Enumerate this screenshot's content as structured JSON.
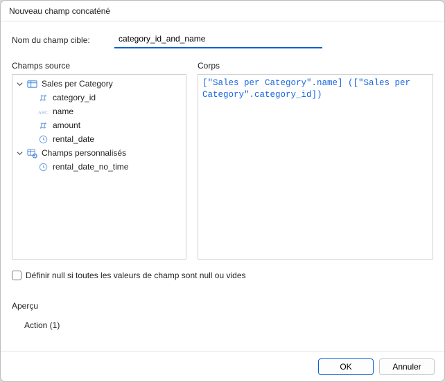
{
  "title": "Nouveau champ concaténé",
  "target": {
    "label": "Nom du champ cible:",
    "value": "category_id_and_name"
  },
  "source": {
    "label": "Champs source",
    "nodes": [
      {
        "type": "group",
        "icon": "table-icon",
        "label": "Sales per Category"
      },
      {
        "type": "field",
        "icon": "hash-icon",
        "label": "category_id"
      },
      {
        "type": "field",
        "icon": "abc-icon",
        "label": "name"
      },
      {
        "type": "field",
        "icon": "hash-icon",
        "label": "amount"
      },
      {
        "type": "field",
        "icon": "clock-icon",
        "label": "rental_date"
      },
      {
        "type": "group",
        "icon": "custom-icon",
        "label": "Champs personnalisés"
      },
      {
        "type": "field",
        "icon": "clock-icon",
        "label": "rental_date_no_time"
      }
    ]
  },
  "body": {
    "label": "Corps",
    "text": "[\"Sales per Category\".name] ([\"Sales per Category\".category_id])"
  },
  "nullcheck": {
    "checked": false,
    "label": "Définir null si toutes les valeurs de champ sont null ou vides"
  },
  "preview": {
    "label": "Aperçu",
    "value": "Action (1)"
  },
  "buttons": {
    "ok": "OK",
    "cancel": "Annuler"
  }
}
